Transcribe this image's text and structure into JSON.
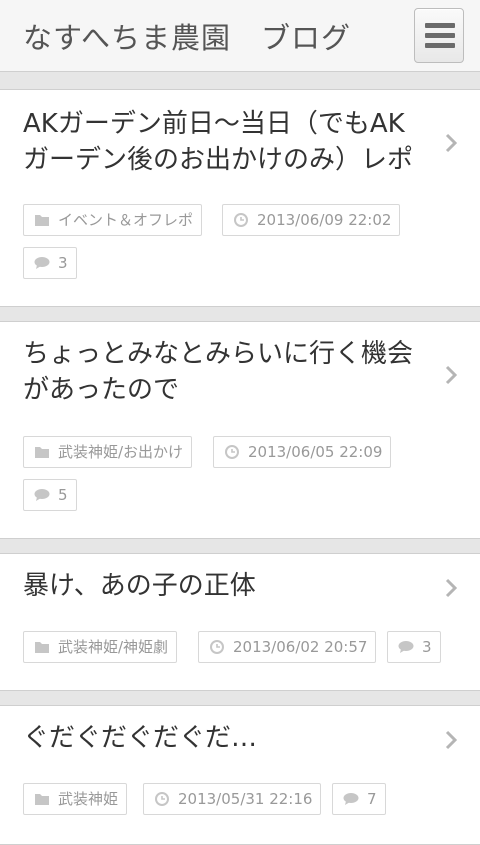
{
  "header": {
    "site_title": "なすへちま農園　ブログ",
    "menu_icon": "hamburger-menu-icon"
  },
  "posts": [
    {
      "title": "AKガーデン前日～当日（でもAKガーデン後のお出かけのみ）レポ",
      "category": "イベント＆オフレポ",
      "date": "2013/06/09 22:02",
      "comments": "3"
    },
    {
      "title": "ちょっとみなとみらいに行く機会があったので",
      "category": "武装神姫/お出かけ",
      "date": "2013/06/05 22:09",
      "comments": "5"
    },
    {
      "title": "暴け、あの子の正体",
      "category": "武装神姫/神姫劇",
      "date": "2013/06/02 20:57",
      "comments": "3"
    },
    {
      "title": "ぐだぐだぐだぐだ…",
      "category": "武装神姫",
      "date": "2013/05/31 22:16",
      "comments": "7"
    }
  ],
  "icons": {
    "category": "folder-icon",
    "date": "clock-icon",
    "comments": "comment-bubble-icon",
    "open": "chevron-right-icon"
  },
  "colors": {
    "progress_bar": "#3a9a23",
    "meta_text": "#999999"
  }
}
